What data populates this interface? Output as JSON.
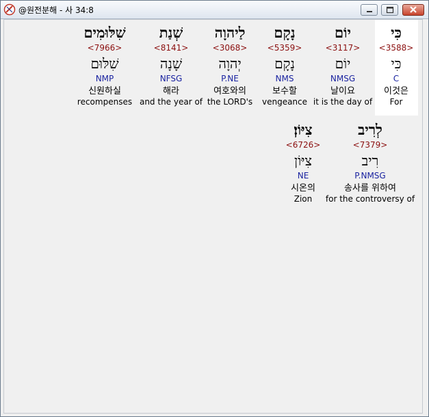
{
  "window": {
    "title": "@원전분해 - 사 34:8",
    "icon": "app-logo-icon",
    "buttons": [
      "minimize-icon",
      "maximize-icon",
      "close-icon"
    ]
  },
  "words": [
    {
      "heb": "כִּי",
      "strong": "<3588>",
      "lex": "כִּי",
      "morph": "C",
      "kor": "이것은",
      "eng": "For",
      "selected": true
    },
    {
      "heb": "יוֹם",
      "strong": "<3117>",
      "lex": "יוֹם",
      "morph": "NMSG",
      "kor": "날이요",
      "eng": "it is the day of"
    },
    {
      "heb": "נָקָם",
      "strong": "<5359>",
      "lex": "נָקָם",
      "morph": "NMS",
      "kor": "보수할",
      "eng": "vengeance"
    },
    {
      "heb": "לַיהוָה",
      "strong": "<3068>",
      "lex": "יְהוָה",
      "morph": "P.NE",
      "kor": "여호와의",
      "eng": "the LORD's"
    },
    {
      "heb": "שְׁנַת",
      "strong": "<8141>",
      "lex": "שָׁנָה",
      "morph": "NFSG",
      "kor": "해라",
      "eng": "and the year of"
    },
    {
      "heb": "שִׁלּוּמִים",
      "strong": "<7966>",
      "lex": "שִׁלּוּם",
      "morph": "NMP",
      "kor": "신원하실",
      "eng": "recompenses"
    },
    {
      "heb": "לְרִיב",
      "strong": "<7379>",
      "lex": "רִיב",
      "morph": "P.NMSG",
      "kor": "송사를 위하여",
      "eng": "for the controversy of"
    },
    {
      "heb": "צִיּוֹן׃",
      "strong": "<6726>",
      "lex": "צִיּוֹן",
      "morph": "NE",
      "kor": "시온의",
      "eng": "Zion"
    }
  ]
}
